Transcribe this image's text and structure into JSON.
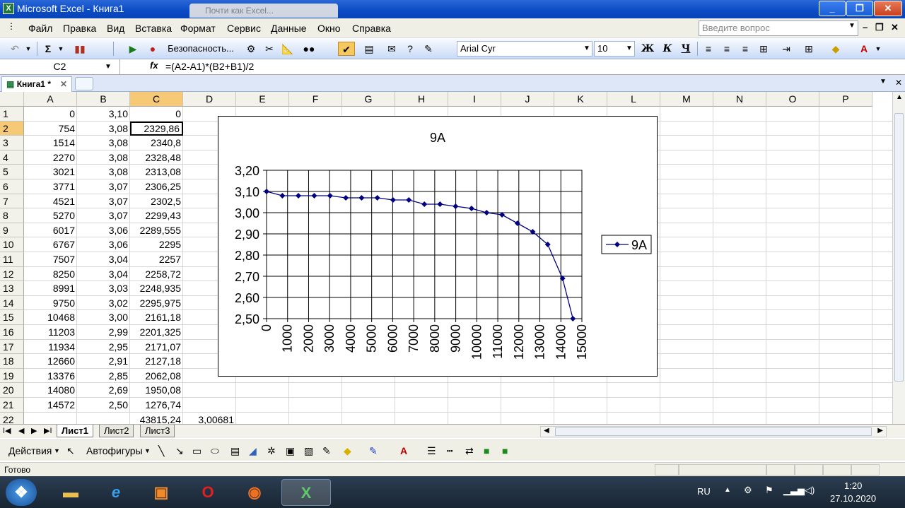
{
  "window": {
    "title": "Microsoft Excel - Книга1",
    "background_tab": "Почти как Excel..."
  },
  "menu": [
    "Файл",
    "Правка",
    "Вид",
    "Вставка",
    "Формат",
    "Сервис",
    "Данные",
    "Окно",
    "Справка"
  ],
  "ask_placeholder": "Введите вопрос",
  "toolbar": {
    "security": "Безопасность...",
    "font": "Arial Cyr",
    "size": "10",
    "bold": "Ж",
    "italic": "К",
    "underline": "Ч"
  },
  "formula_bar": {
    "name_box": "C2",
    "fx": "fx",
    "formula": "=(A2-A1)*(B2+B1)/2"
  },
  "workbook_tab": "Книга1 *",
  "columns": [
    "A",
    "B",
    "C",
    "D",
    "E",
    "F",
    "G",
    "H",
    "I",
    "J",
    "K",
    "L",
    "M",
    "N",
    "O",
    "P"
  ],
  "rows": [
    [
      "0",
      "3,10",
      "0"
    ],
    [
      "754",
      "3,08",
      "2329,86"
    ],
    [
      "1514",
      "3,08",
      "2340,8"
    ],
    [
      "2270",
      "3,08",
      "2328,48"
    ],
    [
      "3021",
      "3,08",
      "2313,08"
    ],
    [
      "3771",
      "3,07",
      "2306,25"
    ],
    [
      "4521",
      "3,07",
      "2302,5"
    ],
    [
      "5270",
      "3,07",
      "2299,43"
    ],
    [
      "6017",
      "3,06",
      "2289,555"
    ],
    [
      "6767",
      "3,06",
      "2295"
    ],
    [
      "7507",
      "3,04",
      "2257"
    ],
    [
      "8250",
      "3,04",
      "2258,72"
    ],
    [
      "8991",
      "3,03",
      "2248,935"
    ],
    [
      "9750",
      "3,02",
      "2295,975"
    ],
    [
      "10468",
      "3,00",
      "2161,18"
    ],
    [
      "11203",
      "2,99",
      "2201,325"
    ],
    [
      "11934",
      "2,95",
      "2171,07"
    ],
    [
      "12660",
      "2,91",
      "2127,18"
    ],
    [
      "13376",
      "2,85",
      "2062,08"
    ],
    [
      "14080",
      "2,69",
      "1950,08"
    ],
    [
      "14572",
      "2,50",
      "1276,74"
    ]
  ],
  "row22": {
    "C": "43815,24",
    "D": "3,00681"
  },
  "chart_data": {
    "type": "line",
    "title": "9A",
    "series": [
      {
        "name": "9A",
        "x": [
          0,
          754,
          1514,
          2270,
          3021,
          3771,
          4521,
          5270,
          6017,
          6767,
          7507,
          8250,
          8991,
          9750,
          10468,
          11203,
          11934,
          12660,
          13376,
          14080,
          14572
        ],
        "y": [
          3.1,
          3.08,
          3.08,
          3.08,
          3.08,
          3.07,
          3.07,
          3.07,
          3.06,
          3.06,
          3.04,
          3.04,
          3.03,
          3.02,
          3.0,
          2.99,
          2.95,
          2.91,
          2.85,
          2.69,
          2.5
        ]
      }
    ],
    "xlim": [
      0,
      15000
    ],
    "ylim": [
      2.5,
      3.2
    ],
    "x_ticks": [
      "0",
      "1000",
      "2000",
      "3000",
      "4000",
      "5000",
      "6000",
      "7000",
      "8000",
      "9000",
      "10000",
      "11000",
      "12000",
      "13000",
      "14000",
      "15000"
    ],
    "y_ticks": [
      "3,20",
      "3,10",
      "3,00",
      "2,90",
      "2,80",
      "2,70",
      "2,60",
      "2,50"
    ],
    "grid": true,
    "legend": "right",
    "color": "#000080"
  },
  "sheet_tabs": [
    "Лист1",
    "Лист2",
    "Лист3"
  ],
  "drawing": {
    "actions": "Действия",
    "autoshapes": "Автофигуры"
  },
  "status": "Готово",
  "tray": {
    "lang": "RU",
    "time": "1:20",
    "date": "27.10.2020"
  }
}
